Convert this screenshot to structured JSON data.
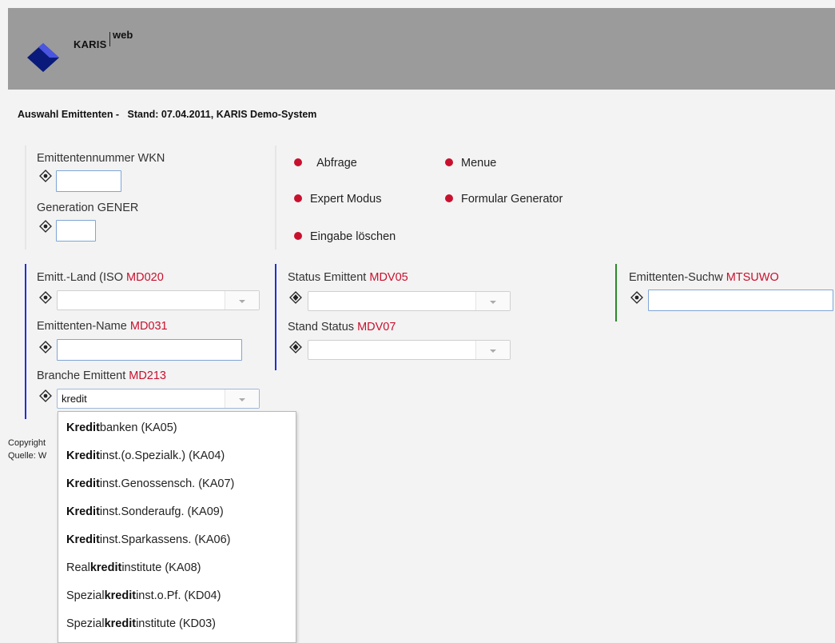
{
  "header": {
    "brand": "KARIS",
    "brand_suffix": "web"
  },
  "page": {
    "title": "Auswahl Emittenten -",
    "stand": "Stand: 07.04.2011, KARIS Demo-System"
  },
  "fields_top": {
    "emittentennummer": {
      "label": "Emittentennummer  WKN",
      "value": ""
    },
    "generation": {
      "label": "Generation  GENER",
      "value": ""
    }
  },
  "actions": [
    {
      "label": "Abfrage"
    },
    {
      "label": "Menue"
    },
    {
      "label": "Expert Modus"
    },
    {
      "label": "Formular Generator"
    },
    {
      "label": "Eingabe löschen"
    }
  ],
  "fields": {
    "emitt_land": {
      "label": "Emitt.-Land (ISO ",
      "code": "MD020",
      "value": ""
    },
    "emittenten_name": {
      "label": "Emittenten-Name ",
      "code": "MD031",
      "value": ""
    },
    "branche": {
      "label": "Branche Emittent ",
      "code": "MD213",
      "value": "kredit"
    },
    "status_emittent": {
      "label": "Status Emittent ",
      "code": "MDV05",
      "value": ""
    },
    "stand_status": {
      "label": "Stand Status ",
      "code": "MDV07",
      "value": ""
    },
    "suchwort": {
      "label": "Emittenten-Suchw ",
      "code": "MTSUWO",
      "value": ""
    }
  },
  "footer": {
    "copyright": "Copyright",
    "quelle": "Quelle: W"
  },
  "dropdown": {
    "items": [
      {
        "pre": "",
        "match": "Kredit",
        "post": "banken (KA05)"
      },
      {
        "pre": "",
        "match": "Kredit",
        "post": "inst.(o.Spezialk.) (KA04)"
      },
      {
        "pre": "",
        "match": "Kredit",
        "post": "inst.Genossensch. (KA07)"
      },
      {
        "pre": "",
        "match": "Kredit",
        "post": "inst.Sonderaufg. (KA09)"
      },
      {
        "pre": "",
        "match": "Kredit",
        "post": "inst.Sparkassens. (KA06)"
      },
      {
        "pre": "Real",
        "match": "kredit",
        "post": "institute (KA08)"
      },
      {
        "pre": "Spezial",
        "match": "kredit",
        "post": "inst.o.Pf. (KD04)"
      },
      {
        "pre": "Spezial",
        "match": "kredit",
        "post": "institute (KD03)"
      }
    ]
  },
  "colors": {
    "header_bg": "#9b9b9b",
    "accent_red": "#c8102e",
    "bar_blue": "#1f2fd8",
    "bar_green": "#2a8a2a",
    "logo_dark": "#0a1a7a",
    "logo_light": "#4a55e0"
  }
}
